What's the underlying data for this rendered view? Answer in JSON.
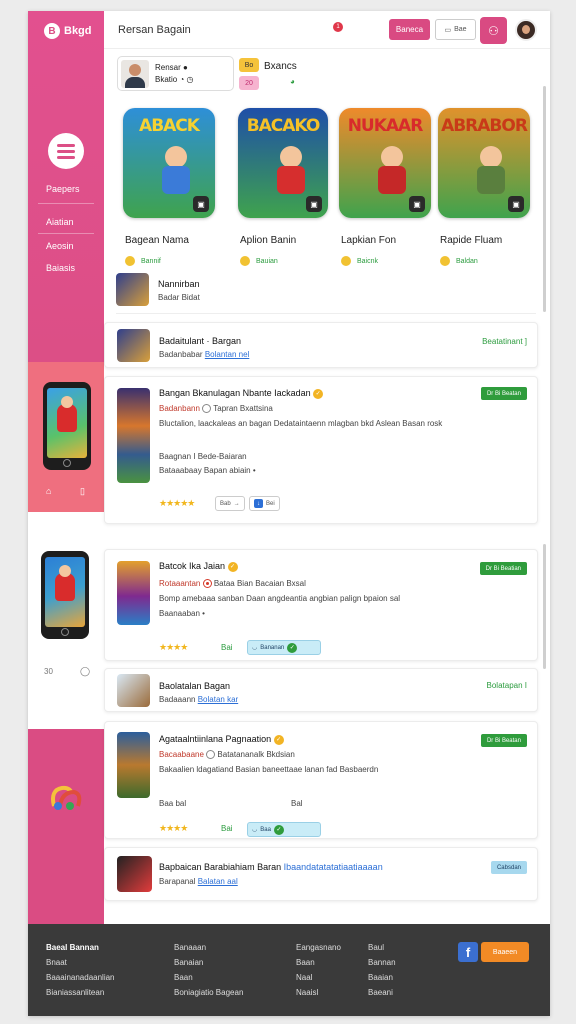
{
  "app": {
    "logo_text": "Bkgd",
    "logo_glyph": "B"
  },
  "header": {
    "title": "Rersan Bagain",
    "notif_count": "1",
    "pink_button": "Baneca",
    "outline_button": "Bae",
    "icon_button_glyph": "⚇",
    "avatar_icon": "user-avatar"
  },
  "sidebar": {
    "items": [
      {
        "label": "Paepers"
      },
      {
        "label": "Aiatian"
      },
      {
        "label": "Aeosin"
      },
      {
        "label": "Baiasis"
      }
    ],
    "bottom_icons": [
      "⌂",
      "▯"
    ],
    "bottom_icons_2": [
      "30",
      "◯"
    ]
  },
  "profile": {
    "name": "Rensar ●",
    "meta": "Bkatio ◔ ◷",
    "badge_1": "Bo",
    "badge_2": "20",
    "games_label": "Bxancs",
    "games_sub": "◕"
  },
  "tiles": [
    {
      "art_title": "ABACK",
      "name": "Bagean Nama",
      "meta": "Bannif",
      "colors": {
        "bg": "#2e8fd8",
        "title": "#f5d232",
        "body": "#3b7bd8"
      }
    },
    {
      "art_title": "BACAKO",
      "name": "Aplion Banin",
      "meta": "Bauian",
      "colors": {
        "bg": "#1f4fa8",
        "title": "#f5c128",
        "body": "#d62e2e"
      }
    },
    {
      "art_title": "NUKAAR",
      "name": "Lapkian Fon",
      "meta": "Baicnk",
      "colors": {
        "bg": "#ef8a2b",
        "title": "#d82b2b",
        "body": "#c52828"
      }
    },
    {
      "art_title": "ABRABOR",
      "name": "Rapide Fluam",
      "meta": "Baldan",
      "colors": {
        "bg": "#e0922c",
        "title": "#c93a18",
        "body": "#5a7f3e"
      }
    }
  ],
  "list": {
    "row1": {
      "title": "Nannirban",
      "sub": "Badar Bidat"
    },
    "row2": {
      "title": "Badaitulant · Bargan",
      "sub": "Badanbabar",
      "link": "Bolantan nel",
      "status": "Beatatinant ]"
    },
    "card1": {
      "title": "Bangan Bkanulagan Nbante Iackadan",
      "pill": "Dr Bi Beatan",
      "subtitle": "Badanbann",
      "subtitle_2": "Tapran Bxattsina",
      "desc": "Bluctalion, laackaleas an bagan Dedataintaenn mlagban bkd Aslean Basan rosk",
      "line_a": "Baagnan I Bede-Baiaran",
      "line_b": "Bataaabaay Bapan abiain •",
      "stars": "★★★★★",
      "chip_1": "Bab",
      "chip_2": "Bei"
    },
    "card2": {
      "title": "Batcok Ika Jaian",
      "pill": "Dr Bi Beatian",
      "subtitle": "Rotaaantan",
      "subtitle_2": "Bataa Bian Bacaian Bxsal",
      "desc": "Bomp amebaaa sanban Daan angdeantia angbian palign bpaion sal",
      "line_a": "Baanaaban •",
      "stars": "★★★★",
      "count": "Bai",
      "chip": "Bananan"
    },
    "row3": {
      "title": "Baolatalan Bagan",
      "sub": "Badaaann",
      "link": "Bolatan kar",
      "status": "Bolatapan I"
    },
    "card3": {
      "title": "Agataalntiinlana Pagnaation",
      "pill": "Dr Bi Beatan",
      "subtitle": "Bacaabaane",
      "subtitle_2": "Batatananalk Bkdsian",
      "desc": "Bakaalien ldagatiand Basian baneettaae lanan fad Basbaerdn",
      "line_a": "Baa bal",
      "line_b": "Bal",
      "stars": "★★★★",
      "count": "Bai",
      "chip": "Baa"
    },
    "row4": {
      "title": "Bapbaican Barabiahiam Baran",
      "title_link": "Ibaandatatatatiaatiaaaan",
      "sub": "Barapanal",
      "link": "Balatan aal",
      "pill": "Cabsdan"
    }
  },
  "footer": {
    "col1": [
      "Baeal Bannan",
      "Bnaat",
      "Baaainanadaanlian",
      "Bianiassanlitean"
    ],
    "col2": [
      "Banaaan",
      "Banaian",
      "Baan",
      "Boniagiatio Bagean"
    ],
    "col3": [
      "Eangasnano",
      "Baan",
      "Naal",
      "Naaisl"
    ],
    "col4": [
      "Baul",
      "Bannan",
      "Baaian",
      "Baeani"
    ],
    "fb": "f",
    "cta": "Baaeen"
  }
}
